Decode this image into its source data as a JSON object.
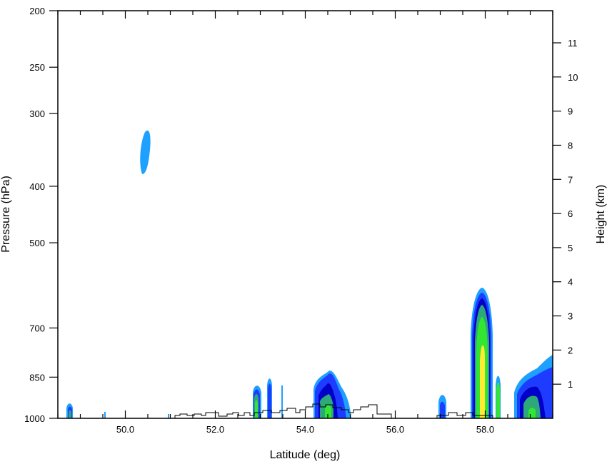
{
  "chart_data": {
    "type": "heatmap",
    "title": "",
    "xlabel": "Latitude (deg)",
    "ylabel": "Pressure (hPa)",
    "y2label": "Height (km)",
    "xlim": [
      48.5,
      59.5
    ],
    "ylim": [
      1000,
      200
    ],
    "y_scale": "log",
    "x_tick_labels": [
      "50.0",
      "52.0",
      "54.0",
      "56.0",
      "58.0"
    ],
    "x_tick_values": [
      50,
      52,
      54,
      56,
      58
    ],
    "y_tick_labels": [
      "200",
      "250",
      "300",
      "400",
      "500",
      "700",
      "850",
      "1000"
    ],
    "y_tick_values": [
      200,
      250,
      300,
      400,
      500,
      700,
      850,
      1000
    ],
    "y2_tick_labels": [
      "1",
      "2",
      "3",
      "4",
      "5",
      "6",
      "7",
      "8",
      "9",
      "10",
      "11"
    ],
    "y2_tick_values": [
      1,
      2,
      3,
      4,
      5,
      6,
      7,
      8,
      9,
      10,
      11
    ],
    "levels_colors": [
      "#1ea0ff",
      "#1e3cff",
      "#0000c8",
      "#2ca87a",
      "#32e632",
      "#ffeb32"
    ],
    "grid": false,
    "legend": "none"
  }
}
